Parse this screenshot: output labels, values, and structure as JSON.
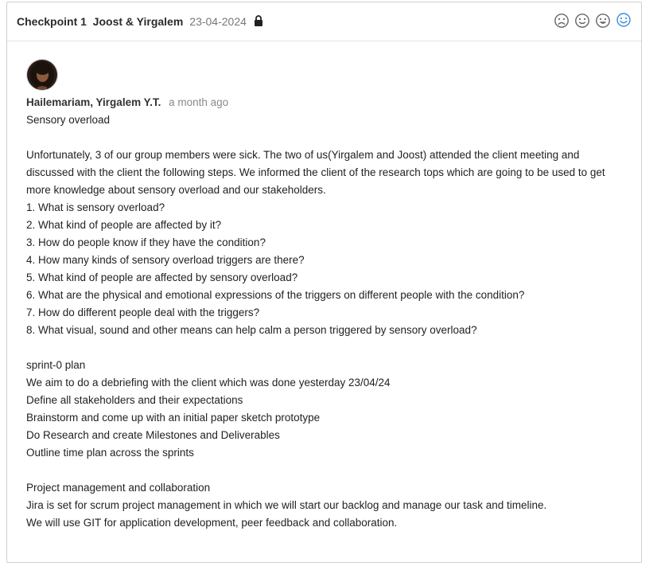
{
  "header": {
    "title": "Checkpoint 1  Joost & Yirgalem",
    "date": "23-04-2024",
    "reactions": [
      {
        "icon": "sad-face-icon",
        "selected": false
      },
      {
        "icon": "neutral-face-icon",
        "selected": false
      },
      {
        "icon": "happy-face-icon",
        "selected": false
      },
      {
        "icon": "very-happy-face-icon",
        "selected": true
      }
    ]
  },
  "post": {
    "author": "Hailemariam, Yirgalem Y.T.",
    "time": "a month ago",
    "lines": [
      "Sensory overload",
      "",
      "Unfortunately, 3 of our group members were sick. The two of us(Yirgalem and Joost) attended the client meeting and",
      "discussed with the client the following steps. We informed the client of the research tops which are going to be used to get",
      "more knowledge about sensory overload and our stakeholders.",
      "1. What is sensory overload?",
      "2. What kind of people are affected by it?",
      "3. How do people know if they have the condition?",
      "4. How many kinds of sensory overload triggers are there?",
      "5. What kind of people are affected by sensory overload?",
      "6. What are the physical and emotional expressions of the triggers on different people with the condition?",
      "7. How do different people deal with the triggers?",
      "8. What visual, sound and other means can help calm a person triggered by sensory overload?",
      "",
      "sprint-0 plan",
      "We aim to do a debriefing with the client which was done yesterday 23/04/24",
      "Define all stakeholders and their expectations",
      "Brainstorm and come up with an initial paper sketch prototype",
      "Do Research and create Milestones and Deliverables",
      "Outline time plan across the sprints",
      "",
      "Project management and collaboration",
      "Jira is set for scrum project management in which we will start our backlog and manage our task and timeline.",
      "We will use GIT for application development, peer feedback and collaboration."
    ]
  },
  "colors": {
    "accent": "#3a8fd6",
    "icon_gray": "#666666"
  }
}
